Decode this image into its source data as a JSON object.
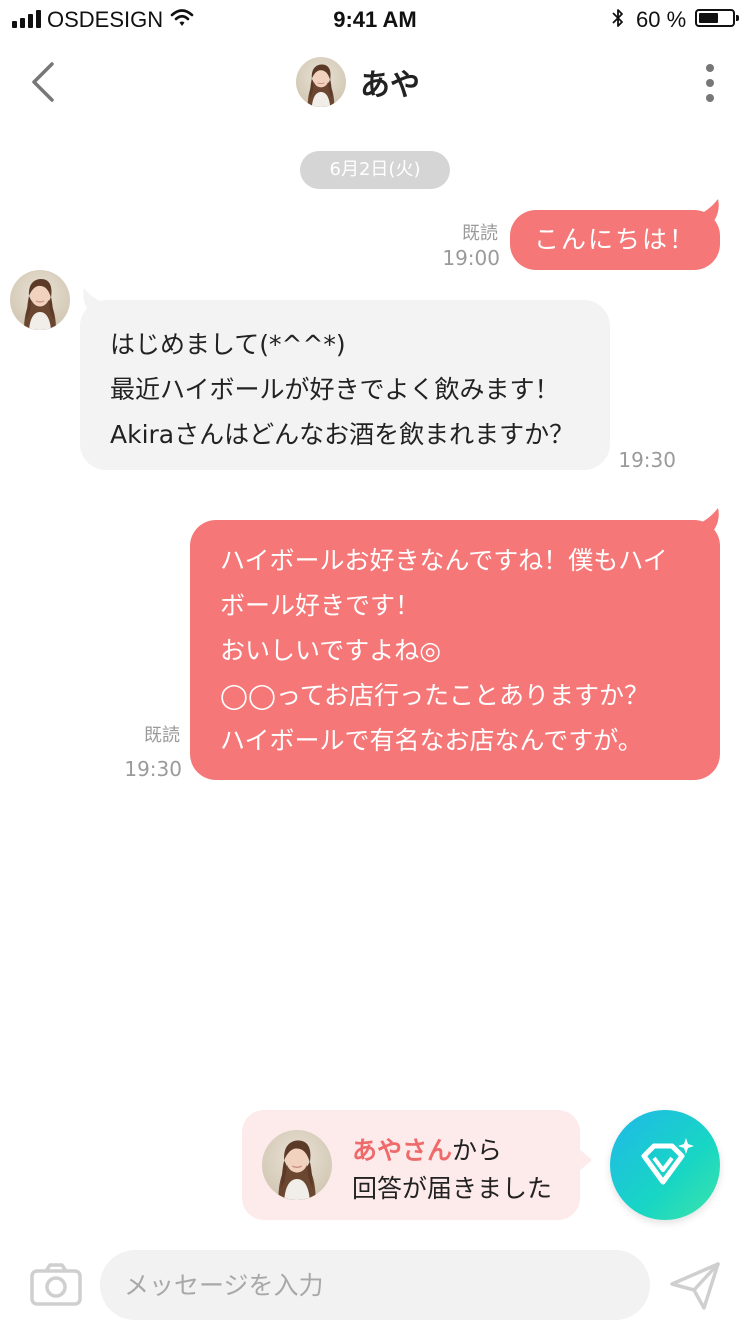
{
  "status_bar": {
    "carrier": "OSDESIGN",
    "time": "9:41 AM",
    "battery": "60 %",
    "battery_level": 0.6,
    "icons": [
      "signal-icon",
      "wifi-icon",
      "bluetooth-icon",
      "battery-icon"
    ]
  },
  "header": {
    "title": "あや",
    "icons": [
      "back-chevron-icon",
      "avatar",
      "more-vertical-icon"
    ]
  },
  "chat": {
    "date": "6月2日(火)",
    "messages": [
      {
        "sender": "me",
        "read": "既読",
        "time": "19:00",
        "lines": [
          "こんにちは！"
        ]
      },
      {
        "sender": "them",
        "time": "19:30",
        "lines": [
          "はじめまして(*^^*)",
          "最近ハイボールが好きでよく飲みます！",
          "Akiraさんはどんなお酒を飲まれますか？"
        ]
      },
      {
        "sender": "me",
        "read": "既読",
        "time": "19:30",
        "lines": [
          "ハイボールお好きなんですね！僕もハイ",
          "ボール好きです！",
          "おいしいですよね◎",
          "◯◯ってお店行ったことありますか？",
          "ハイボールで有名なお店なんですが。"
        ]
      }
    ]
  },
  "notification": {
    "name": "あやさん",
    "suffix": "から",
    "line2": "回答が届きました",
    "fab_icon": "diamond-sparkle-icon"
  },
  "input_bar": {
    "placeholder": "メッセージを入力",
    "value": "",
    "icons": [
      "camera-icon",
      "send-icon"
    ]
  },
  "colors": {
    "accent": "#f57777",
    "them_bubble": "#f3f3f3",
    "meta_text": "#9a9a9a",
    "notification_bg": "#fdeaea",
    "fab_gradient": [
      "#1fb8e8",
      "#3de3a8"
    ]
  }
}
